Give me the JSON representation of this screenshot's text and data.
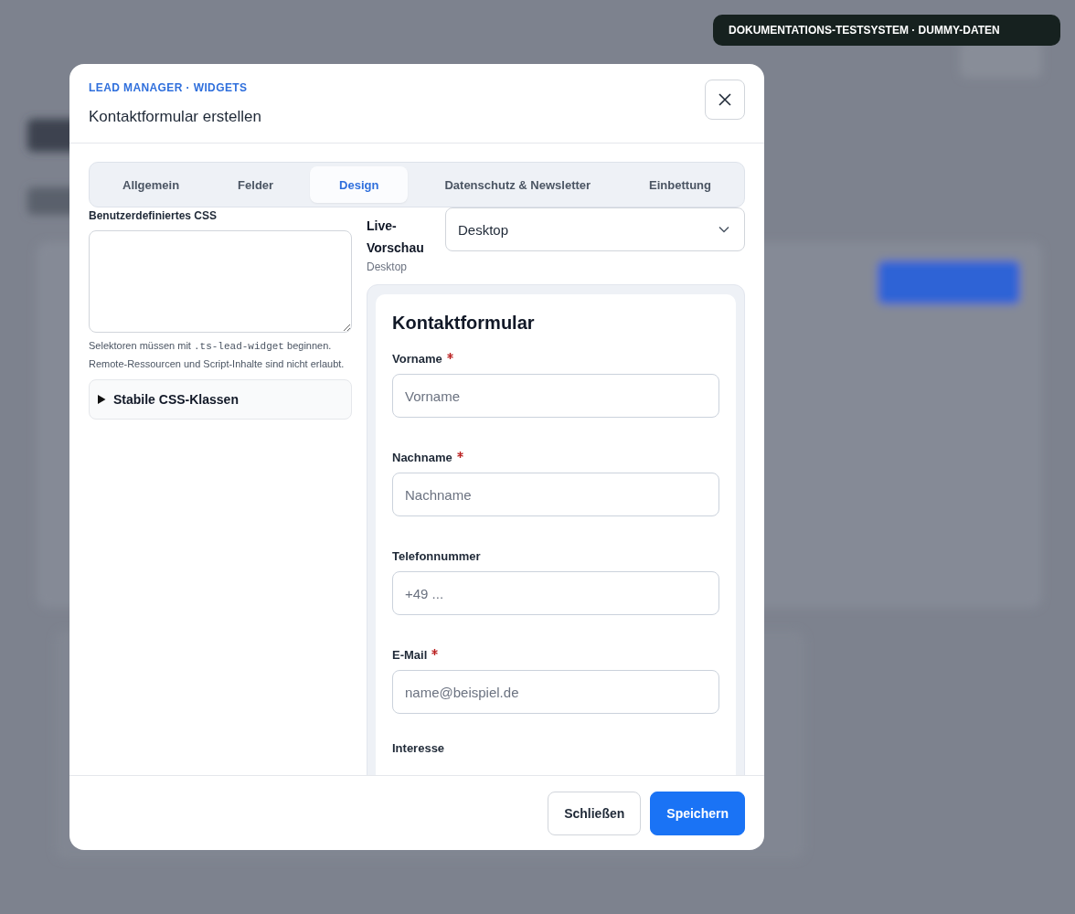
{
  "badge": "DOKUMENTATIONS-TESTSYSTEM · DUMMY-DATEN",
  "dialog": {
    "eyebrow": "LEAD MANAGER · WIDGETS",
    "title": "Kontaktformular erstellen"
  },
  "tabs": [
    {
      "label": "Allgemein",
      "selected": false
    },
    {
      "label": "Felder",
      "selected": false
    },
    {
      "label": "Design",
      "selected": true
    },
    {
      "label": "Datenschutz & Newsletter",
      "selected": false
    },
    {
      "label": "Einbettung",
      "selected": false
    }
  ],
  "custom_css": {
    "label": "Benutzerdefiniertes CSS",
    "hint": [
      {
        "kind": "text",
        "text": "Selektoren müssen mit "
      },
      {
        "kind": "code",
        "text": ".ts-lead-widget"
      },
      {
        "kind": "text",
        "text": " beginnen. Remote-Ressourcen und Script-Inhalte sind nicht erlaubt."
      }
    ],
    "details": {
      "summary": "Stabile CSS-Klassen",
      "expanded": false
    }
  },
  "preview": {
    "label": "Live-Vorschau",
    "device": "Desktop",
    "select_value": "Desktop",
    "form": {
      "title": "Kontaktformular",
      "fields": [
        {
          "label": "Vorname",
          "required": true,
          "placeholder": "Vorname"
        },
        {
          "label": "Nachname",
          "required": true,
          "placeholder": "Nachname"
        },
        {
          "label": "Telefonnummer",
          "required": false,
          "placeholder": "+49 ..."
        },
        {
          "label": "E-Mail",
          "required": true,
          "placeholder": "name@beispiel.de"
        },
        {
          "label": "Interesse",
          "required": false
        }
      ]
    }
  },
  "buttons": [
    {
      "label": "Schließen",
      "kind": "secondary"
    },
    {
      "label": "Speichern",
      "kind": "primary"
    }
  ]
}
